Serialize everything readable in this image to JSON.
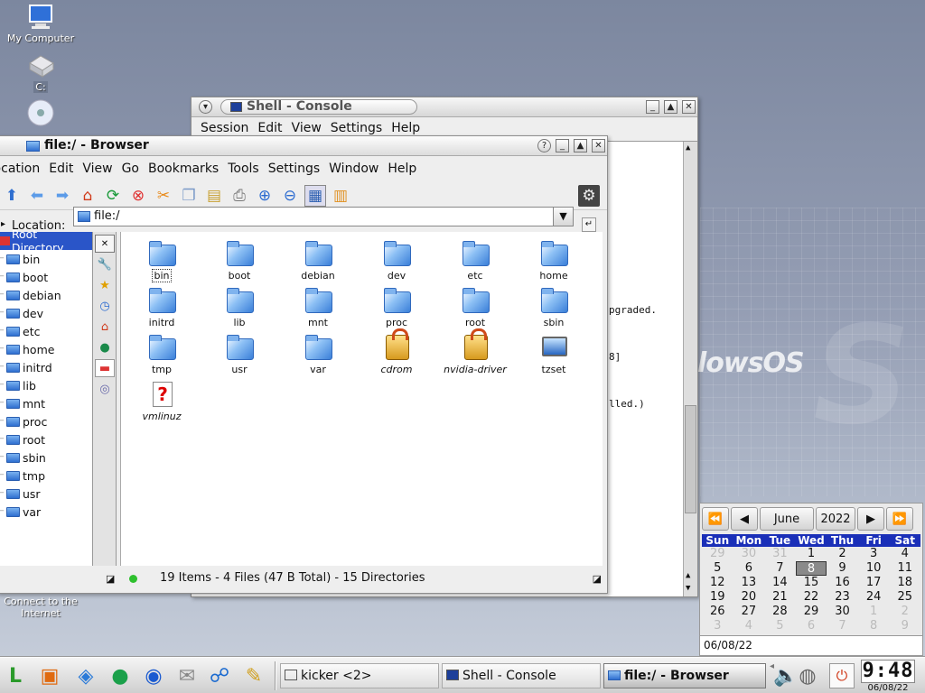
{
  "desktop": {
    "icons": [
      {
        "label": "My Computer"
      },
      {
        "label": "C:"
      },
      {
        "label": "CD-ROM"
      },
      {
        "label": "Connect to the Internet"
      }
    ],
    "watermark": "lowsOS"
  },
  "console": {
    "title": "Shell - Console",
    "menu": [
      "Session",
      "Edit",
      "View",
      "Settings",
      "Help"
    ],
    "lines": [
      "pgraded.",
      "8]",
      "lled.)"
    ]
  },
  "browser": {
    "title": "file:/ - Browser",
    "menu": [
      "Location",
      "Edit",
      "View",
      "Go",
      "Bookmarks",
      "Tools",
      "Settings",
      "Window",
      "Help"
    ],
    "location_label": "Location:",
    "location_value": "file:/",
    "tree_root": "Root Directory",
    "tree": [
      "bin",
      "boot",
      "debian",
      "dev",
      "etc",
      "home",
      "initrd",
      "lib",
      "mnt",
      "proc",
      "root",
      "sbin",
      "tmp",
      "usr",
      "var"
    ],
    "files": [
      {
        "name": "bin",
        "kind": "folder"
      },
      {
        "name": "boot",
        "kind": "folder"
      },
      {
        "name": "debian",
        "kind": "folder"
      },
      {
        "name": "dev",
        "kind": "folder"
      },
      {
        "name": "etc",
        "kind": "folder"
      },
      {
        "name": "home",
        "kind": "folder"
      },
      {
        "name": "initrd",
        "kind": "folder"
      },
      {
        "name": "lib",
        "kind": "folder"
      },
      {
        "name": "mnt",
        "kind": "folder"
      },
      {
        "name": "proc",
        "kind": "folder"
      },
      {
        "name": "root",
        "kind": "folder"
      },
      {
        "name": "sbin",
        "kind": "folder"
      },
      {
        "name": "tmp",
        "kind": "folder"
      },
      {
        "name": "usr",
        "kind": "folder"
      },
      {
        "name": "var",
        "kind": "folder"
      },
      {
        "name": "cdrom",
        "kind": "locked"
      },
      {
        "name": "nvidia-driver",
        "kind": "locked"
      },
      {
        "name": "tzset",
        "kind": "exec"
      },
      {
        "name": "vmlinuz",
        "kind": "unknown"
      }
    ],
    "status": "19 Items - 4 Files (47 B Total) - 15 Directories"
  },
  "calendar": {
    "month": "June",
    "year": "2022",
    "weekdays": [
      "Sun",
      "Mon",
      "Tue",
      "Wed",
      "Thu",
      "Fri",
      "Sat"
    ],
    "weeks": [
      [
        "29",
        "30",
        "31",
        "1",
        "2",
        "3",
        "4"
      ],
      [
        "5",
        "6",
        "7",
        "8",
        "9",
        "10",
        "11"
      ],
      [
        "12",
        "13",
        "14",
        "15",
        "16",
        "17",
        "18"
      ],
      [
        "19",
        "20",
        "21",
        "22",
        "23",
        "24",
        "25"
      ],
      [
        "26",
        "27",
        "28",
        "29",
        "30",
        "1",
        "2"
      ],
      [
        "3",
        "4",
        "5",
        "6",
        "7",
        "8",
        "9"
      ]
    ],
    "selected_day": "8",
    "date_value": "06/08/22",
    "accent": "#1a2fb8"
  },
  "taskbar": {
    "tasks": [
      "kicker <2>",
      "Shell - Console",
      "file:/ - Browser"
    ],
    "active_task": "file:/ - Browser",
    "clock_time": "9:48",
    "clock_date": "06/08/22"
  }
}
